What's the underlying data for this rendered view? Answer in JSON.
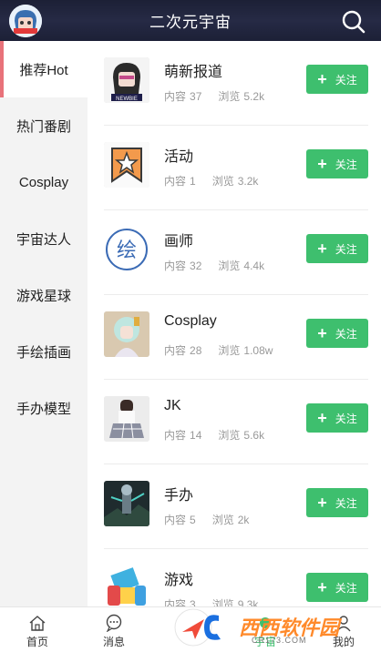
{
  "header": {
    "title": "二次元宇宙"
  },
  "sidebar": {
    "items": [
      {
        "label": "推荐Hot"
      },
      {
        "label": "热门番剧"
      },
      {
        "label": "Cosplay"
      },
      {
        "label": "宇宙达人"
      },
      {
        "label": "游戏星球"
      },
      {
        "label": "手绘插画"
      },
      {
        "label": "手办模型"
      }
    ]
  },
  "list": {
    "content_label": "内容",
    "views_label": "浏览",
    "follow_label": "关注",
    "items": [
      {
        "name": "萌新报道",
        "content": "37",
        "views": "5.2k"
      },
      {
        "name": "活动",
        "content": "1",
        "views": "3.2k"
      },
      {
        "name": "画师",
        "content": "32",
        "views": "4.4k"
      },
      {
        "name": "Cosplay",
        "content": "28",
        "views": "1.08w"
      },
      {
        "name": "JK",
        "content": "14",
        "views": "5.6k"
      },
      {
        "name": "手办",
        "content": "5",
        "views": "2k"
      },
      {
        "name": "游戏",
        "content": "3",
        "views": "9.3k"
      }
    ]
  },
  "bottom_nav": {
    "tabs": [
      {
        "label": "首页"
      },
      {
        "label": "消息"
      },
      {
        "label": "宇宙"
      },
      {
        "label": "我的"
      }
    ]
  },
  "watermark": {
    "text": "西西软件园",
    "sub": "CR173.COM"
  },
  "thumb_glyphs": {
    "huashi": "绘"
  },
  "colors": {
    "accent_green": "#3ebf6e",
    "sidebar_active": "#e8727a",
    "header_bg": "#1c2036"
  }
}
